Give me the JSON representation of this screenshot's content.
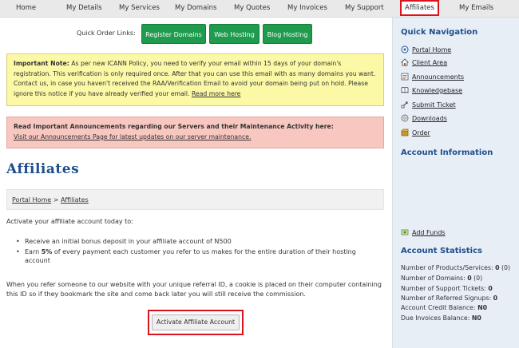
{
  "nav": {
    "items": [
      {
        "label": "Home"
      },
      {
        "label": "My Details"
      },
      {
        "label": "My Services"
      },
      {
        "label": "My Domains"
      },
      {
        "label": "My Quotes"
      },
      {
        "label": "My Invoices"
      },
      {
        "label": "My Support"
      },
      {
        "label": "Affiliates"
      },
      {
        "label": "My Emails"
      }
    ]
  },
  "quick_order": {
    "label": "Quick Order Links:",
    "buttons": [
      "Register Domains",
      "Web Hosting",
      "Blog Hosting"
    ]
  },
  "notice_important": {
    "bold": "Important Note:",
    "text": " As per new ICANN Policy, you need to verify your email within 15 days of your domain's registration. This verification is only required once. After that you can use this email with as many domains you want. Contact us, in case you haven't received the RAA/Verification Email to avoid your domain being put on hold. Please ignore this notice if you have already verified your email.",
    "link": "Read more here"
  },
  "notice_announcements": {
    "bold": "Read Important Announcements regarding our Servers and their Maintenance Activity here:",
    "link": "Visit our Announcements Page for latest updates on our server maintenance."
  },
  "page_title": "Affiliates",
  "breadcrumb": {
    "home": "Portal Home",
    "sep": ">",
    "current": "Affiliates"
  },
  "content": {
    "intro": "Activate your affiliate account today to:",
    "bullet1": "Receive an initial bonus deposit in your affiliate account of N500",
    "bullet2_pre": "Earn ",
    "bullet2_bold": "5%",
    "bullet2_post": " of every payment each customer you refer to us makes for the entire duration of their hosting account",
    "explain": "When you refer someone to our website with your unique referral ID, a cookie is placed on their computer containing this ID so if they bookmark the site and come back later you will still receive the commission.",
    "activate_button": "Activate Affiliate Account"
  },
  "sidebar": {
    "quick_nav_title": "Quick Navigation",
    "links": [
      {
        "label": "Portal Home",
        "icon": "portal-home-icon"
      },
      {
        "label": "Client Area",
        "icon": "client-area-icon"
      },
      {
        "label": "Announcements",
        "icon": "announcements-icon"
      },
      {
        "label": "Knowledgebase",
        "icon": "knowledgebase-icon"
      },
      {
        "label": "Submit Ticket",
        "icon": "submit-ticket-icon"
      },
      {
        "label": "Downloads",
        "icon": "downloads-icon"
      },
      {
        "label": "Order",
        "icon": "order-icon"
      }
    ],
    "account_info_title": "Account Information",
    "add_funds": "Add Funds",
    "account_stats_title": "Account Statistics",
    "stats": [
      {
        "label": "Number of Products/Services: ",
        "value": "0",
        "extra": " (0)"
      },
      {
        "label": "Number of Domains: ",
        "value": "0",
        "extra": " (0)"
      },
      {
        "label": "Number of Support Tickets: ",
        "value": "0",
        "extra": ""
      },
      {
        "label": "Number of Referred Signups: ",
        "value": "0",
        "extra": ""
      },
      {
        "label": "Account Credit Balance: ",
        "value": "N0",
        "extra": ""
      },
      {
        "label": "Due Invoices Balance: ",
        "value": "N0",
        "extra": ""
      }
    ]
  },
  "colors": {
    "green_button": "#1e9b4c",
    "highlight_red": "#d9141c",
    "title_blue": "#1f4e8c",
    "notice_yellow": "#fbf8a6",
    "notice_red": "#f7c7c0",
    "sidebar_bg": "#e8eef6"
  }
}
